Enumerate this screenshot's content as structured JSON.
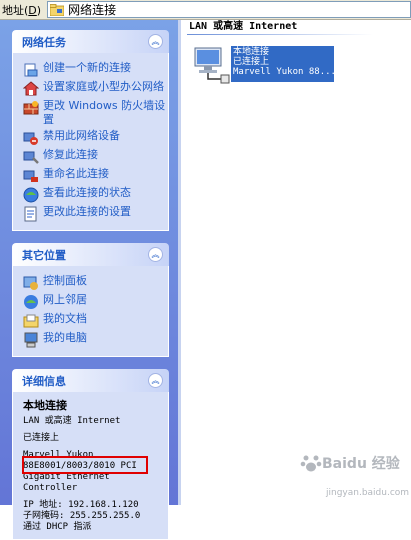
{
  "address_bar": {
    "label": "地址",
    "hotkey": "D",
    "location": "网络连接"
  },
  "left_pane": {
    "network_tasks": {
      "title": "网络任务",
      "items": [
        {
          "label": "创建一个新的连接",
          "icon": "new-connection-icon"
        },
        {
          "label": "设置家庭或小型办公网络",
          "icon": "home-network-icon"
        },
        {
          "label": "更改 Windows 防火墙设置",
          "icon": "firewall-icon"
        },
        {
          "label": "禁用此网络设备",
          "icon": "disable-device-icon"
        },
        {
          "label": "修复此连接",
          "icon": "repair-icon"
        },
        {
          "label": "重命名此连接",
          "icon": "rename-icon"
        },
        {
          "label": "查看此连接的状态",
          "icon": "status-icon"
        },
        {
          "label": "更改此连接的设置",
          "icon": "settings-icon"
        }
      ]
    },
    "other_places": {
      "title": "其它位置",
      "items": [
        {
          "label": "控制面板",
          "icon": "control-panel-icon"
        },
        {
          "label": "网上邻居",
          "icon": "network-places-icon"
        },
        {
          "label": "我的文档",
          "icon": "my-documents-icon"
        },
        {
          "label": "我的电脑",
          "icon": "my-computer-icon"
        }
      ]
    },
    "details": {
      "title": "详细信息",
      "name": "本地连接",
      "type": "LAN 或高速 Internet",
      "status": "已连接上",
      "device": "Marvell Yukon 88E8001/8003/8010 PCI Gigabit Ethernet Controller",
      "ip_line": "IP 地址: 192.168.1.120",
      "mask_line": "子网掩码: 255.255.255.0",
      "dhcp_line": "通过 DHCP 指派"
    }
  },
  "right_pane": {
    "group_title": "LAN 或高速 Internet",
    "connection": {
      "name": "本地连接",
      "status": "已连接上",
      "device": "Marvell Yukon 88..."
    }
  },
  "watermark": {
    "text": "Baidu 经验",
    "sub": "jingyan.baidu.com"
  },
  "colors": {
    "pane_gradient_top": "#7ba2e7",
    "pane_gradient_bottom": "#6375d6",
    "link_blue": "#215dc6",
    "selection_blue": "#316ac5",
    "highlight_red": "#e00000"
  }
}
